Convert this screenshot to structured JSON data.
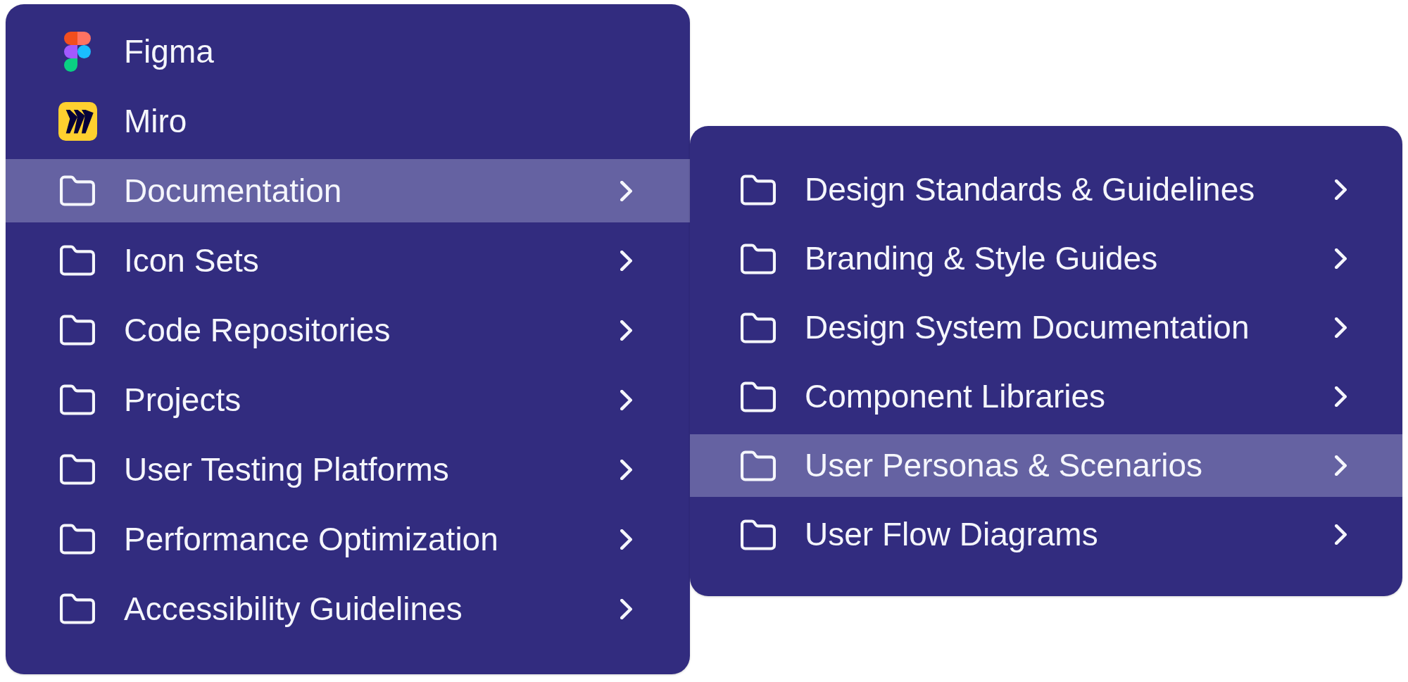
{
  "menu": {
    "items": [
      {
        "kind": "figma",
        "label": "Figma",
        "selected": false
      },
      {
        "kind": "miro",
        "label": "Miro",
        "selected": false
      },
      {
        "kind": "folder",
        "label": "Documentation",
        "selected": true
      },
      {
        "kind": "folder",
        "label": "Icon Sets",
        "selected": false
      },
      {
        "kind": "folder",
        "label": "Code Repositories",
        "selected": false
      },
      {
        "kind": "folder",
        "label": "Projects",
        "selected": false
      },
      {
        "kind": "folder",
        "label": "User Testing Platforms",
        "selected": false
      },
      {
        "kind": "folder",
        "label": "Performance Optimization",
        "selected": false
      },
      {
        "kind": "folder",
        "label": "Accessibility Guidelines",
        "selected": false
      }
    ]
  },
  "submenu": {
    "items": [
      {
        "kind": "folder",
        "label": "Design Standards & Guidelines",
        "selected": false
      },
      {
        "kind": "folder",
        "label": "Branding & Style Guides",
        "selected": false
      },
      {
        "kind": "folder",
        "label": "Design System Documentation",
        "selected": false
      },
      {
        "kind": "folder",
        "label": "Component Libraries",
        "selected": false
      },
      {
        "kind": "folder",
        "label": "User Personas & Scenarios",
        "selected": true
      },
      {
        "kind": "folder",
        "label": "User Flow Diagrams",
        "selected": false
      }
    ]
  }
}
